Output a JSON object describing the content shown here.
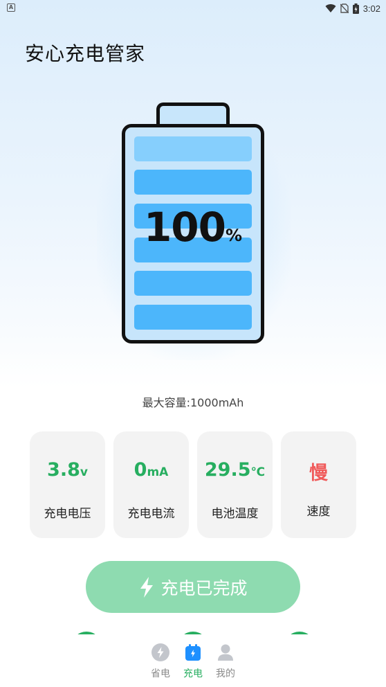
{
  "status_bar": {
    "time": "3:02",
    "app_icon_letter": "A",
    "icons": [
      "wifi-icon",
      "no-sim-icon",
      "battery-icon"
    ]
  },
  "header": {
    "title": "安心充电管家"
  },
  "battery": {
    "percent": "100",
    "percent_unit": "%",
    "level": 1.0,
    "bars": 6
  },
  "capacity_text": "最大容量:1000mAh",
  "stats": [
    {
      "value": "3.8",
      "unit": "v",
      "label": "充电电压"
    },
    {
      "value": "0",
      "unit": "mA",
      "label": "充电电流"
    },
    {
      "value": "29.5",
      "unit": "℃",
      "label": "电池温度"
    },
    {
      "value": "慢",
      "unit": "",
      "label": "速度"
    }
  ],
  "complete_button": {
    "label": "充电已完成",
    "icon": "lightning-icon"
  },
  "bottom_nav": {
    "items": [
      {
        "label": "省电",
        "icon": "power-save-icon",
        "active": false
      },
      {
        "label": "充电",
        "icon": "charge-calendar-icon",
        "active": true
      },
      {
        "label": "我的",
        "icon": "profile-icon",
        "active": false
      }
    ]
  },
  "colors": {
    "accent_green": "#27ae60",
    "button_green_light": "#8edbb0",
    "battery_bar_blue": "#4cb6fb",
    "slow_red": "#f05a5a",
    "card_bg": "#f3f3f3"
  }
}
